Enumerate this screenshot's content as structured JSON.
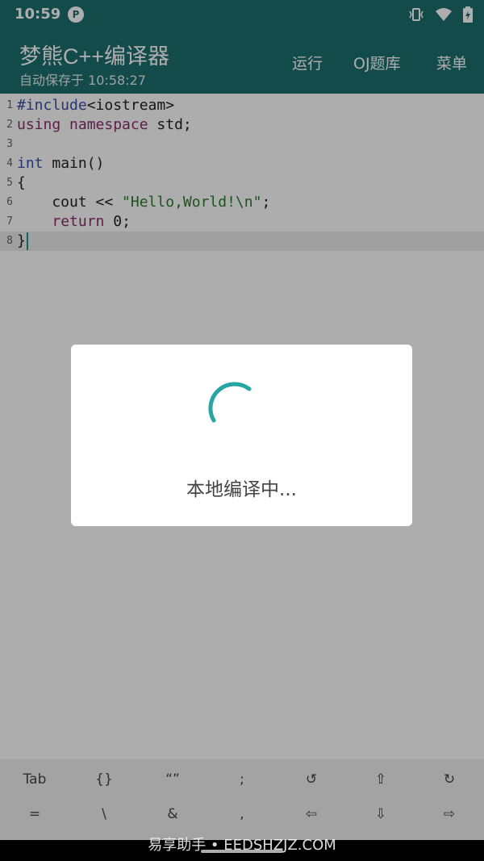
{
  "status_bar": {
    "time": "10:59",
    "app_icon_letter": "P"
  },
  "app_bar": {
    "title": "梦熊C++编译器",
    "subtitle": "自动保存于 10:58:27",
    "actions": [
      "运行",
      "OJ题库",
      "菜单"
    ]
  },
  "editor": {
    "line_numbers": [
      "1",
      "2",
      "3",
      "4",
      "5",
      "6",
      "7",
      "8"
    ],
    "l1": {
      "directive": "#include",
      "rest": "<iostream>"
    },
    "l2": {
      "kw1": "using",
      "kw2": "namespace",
      "rest": " std;"
    },
    "l4": {
      "kw": "int",
      "rest": " main()"
    },
    "l5": {
      "text": "{"
    },
    "l6": {
      "pre": "    cout << ",
      "str": "\"Hello,World!\\n\"",
      "post": ";"
    },
    "l7": {
      "pre": "    ",
      "kw": "return",
      "post": " 0;"
    },
    "l8": {
      "text": "}"
    }
  },
  "keyboard_bar": {
    "row1": [
      "Tab",
      "{}",
      "“”",
      ";",
      "↺",
      "⇧",
      "↻"
    ],
    "row2": [
      "=",
      "\\",
      "&",
      ",",
      "⇦",
      "⇩",
      "⇨"
    ]
  },
  "dialog": {
    "message": "本地编译中..."
  },
  "watermark": "易享助手 • EEDSHZJZ.COM",
  "colors": {
    "primary": "#1c6e6e",
    "spinner": "#26a5a5",
    "keyword_blue": "#3a4ea8",
    "keyword_purple": "#8a2e6b",
    "string_green": "#2d7a2d"
  }
}
